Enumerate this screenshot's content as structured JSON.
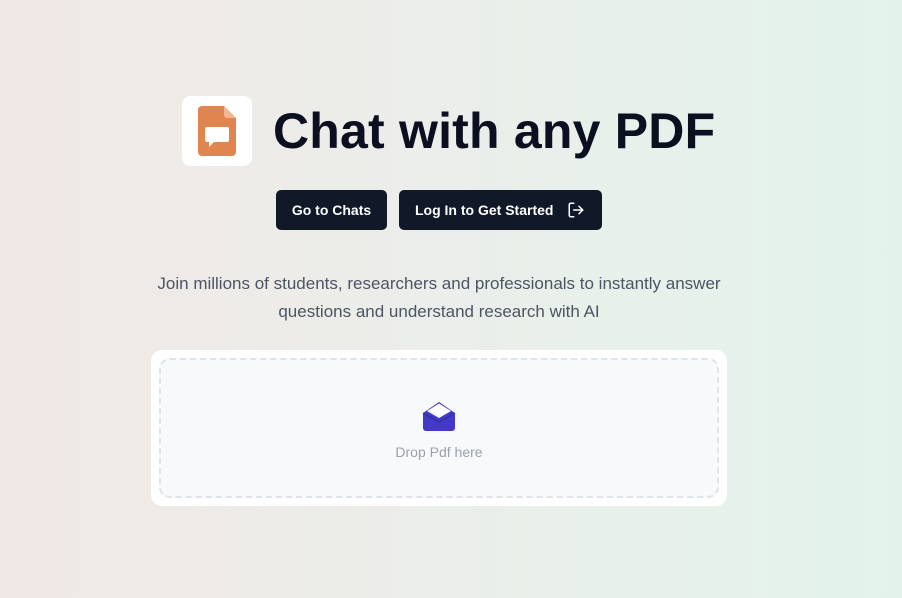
{
  "hero": {
    "title": "Chat with any PDF",
    "logo_icon": "pdf-chat-icon",
    "subtitle": "Join millions of students, researchers and professionals to instantly answer questions and understand research with AI"
  },
  "buttons": {
    "go_to_chats": "Go to Chats",
    "login": "Log In to Get Started",
    "login_icon": "log-in-icon"
  },
  "dropzone": {
    "text": "Drop Pdf here",
    "icon": "inbox-icon"
  },
  "colors": {
    "logo_accent": "#e0854f",
    "button_bg": "#111827",
    "inbox_icon": "#4338ca"
  }
}
